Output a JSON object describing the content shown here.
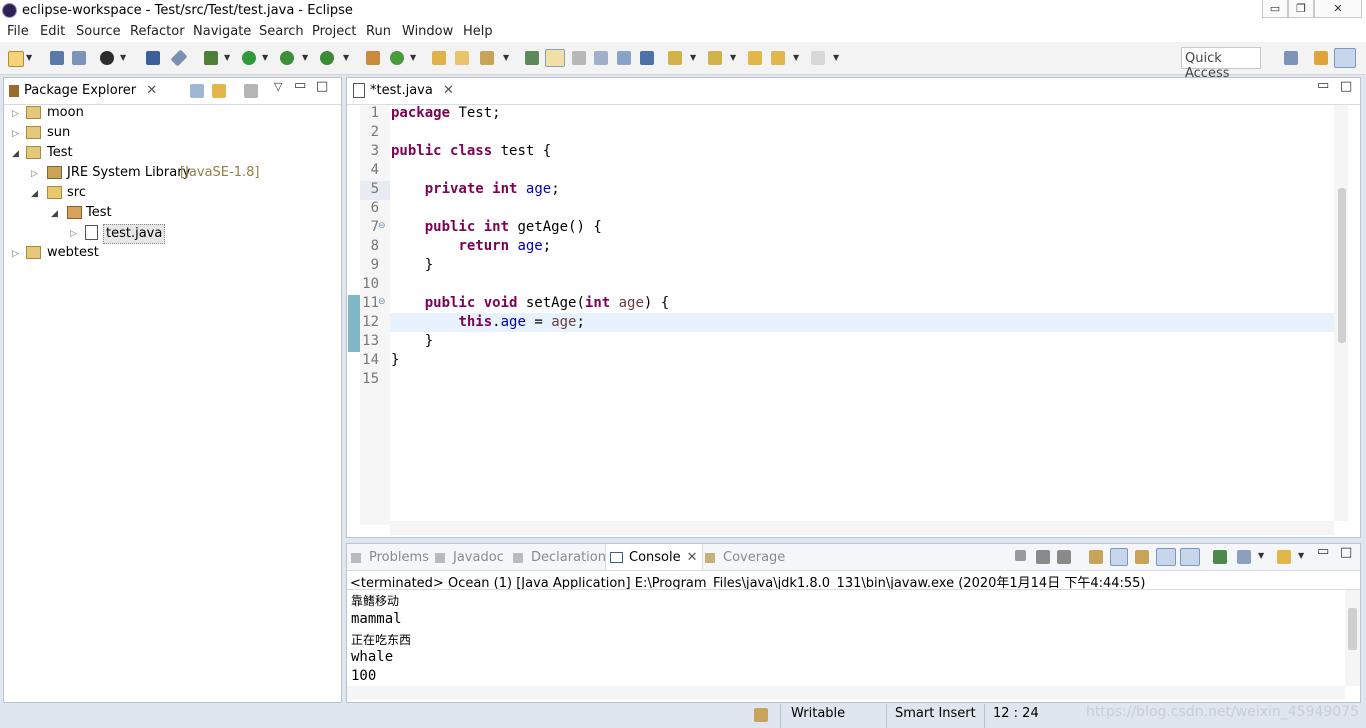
{
  "window": {
    "title": "eclipse-workspace - Test/src/Test/test.java - Eclipse",
    "minimize": "▭",
    "restore": "❐",
    "close": "✕"
  },
  "menu": [
    "File",
    "Edit",
    "Source",
    "Refactor",
    "Navigate",
    "Search",
    "Project",
    "Run",
    "Window",
    "Help"
  ],
  "toolbar": {
    "quick_access": "Quick Access"
  },
  "package_explorer": {
    "title": "Package Explorer",
    "items": [
      {
        "label": "moon",
        "icon": "project-icon"
      },
      {
        "label": "sun",
        "icon": "project-icon"
      },
      {
        "label": "Test",
        "icon": "project-icon"
      },
      {
        "label": "JRE System Library",
        "suffix": "[JavaSE-1.8]",
        "icon": "library-icon"
      },
      {
        "label": "src",
        "icon": "folder-icon"
      },
      {
        "label": "Test",
        "icon": "package-icon"
      },
      {
        "label": "test.java",
        "icon": "java-file-icon"
      },
      {
        "label": "webtest",
        "icon": "project-icon"
      }
    ]
  },
  "editor": {
    "tab": "*test.java",
    "line_numbers": [
      "1",
      "2",
      "3",
      "4",
      "5",
      "6",
      "7",
      "8",
      "9",
      "10",
      "11",
      "12",
      "13",
      "14",
      "15"
    ]
  },
  "console": {
    "tabs": [
      "Problems",
      "Javadoc",
      "Declaration",
      "Console",
      "Coverage"
    ],
    "terminated": "<terminated> Ocean (1) [Java Application] E:\\Program_Files\\java\\jdk1.8.0_131\\bin\\javaw.exe (2020年1月14日 下午4:44:55)",
    "output": [
      "靠鳍移动",
      "mammal",
      "正在吃东西",
      "whale",
      "100"
    ]
  },
  "status": {
    "writable": "Writable",
    "insert_mode": "Smart Insert",
    "position": "12 : 24",
    "watermark": "https://blog.csdn.net/weixin_45949075"
  },
  "colors": {
    "keyword": "#7f0055",
    "field": "#0000c0",
    "local": "#6a3e3e",
    "linenum": "#787878",
    "current_line": "#e8f2fe"
  }
}
